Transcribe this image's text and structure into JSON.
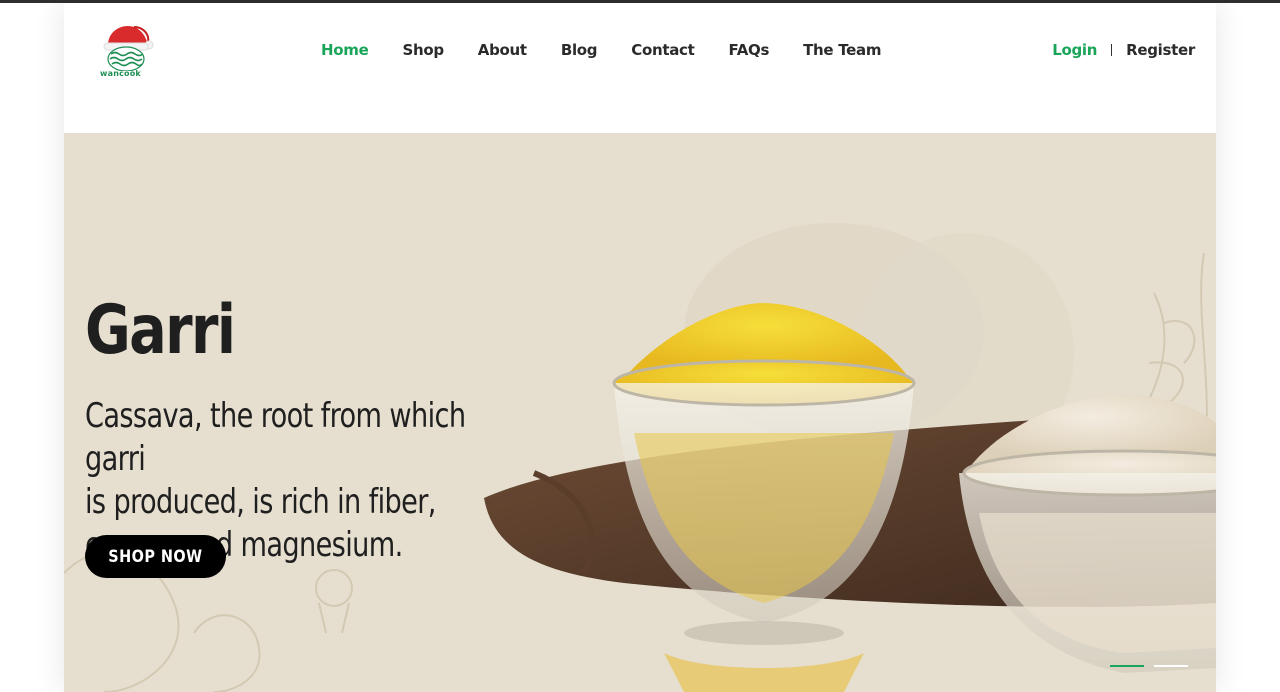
{
  "brand": {
    "name": "wancook",
    "logo_icon": "santa-hat-wave-logo",
    "accent": "#1aa55a"
  },
  "nav": {
    "items": [
      {
        "label": "Home",
        "active": true
      },
      {
        "label": "Shop",
        "active": false
      },
      {
        "label": "About",
        "active": false
      },
      {
        "label": "Blog",
        "active": false
      },
      {
        "label": "Contact",
        "active": false
      },
      {
        "label": "FAQs",
        "active": false
      },
      {
        "label": "The Team",
        "active": false
      }
    ]
  },
  "auth": {
    "login": "Login",
    "register": "Register"
  },
  "hero": {
    "title": "Garri",
    "subtitle_lines": [
      "Cassava, the root from which garri",
      "is produced, is rich in fiber,",
      "copper and magnesium."
    ],
    "cta": "SHOP NOW",
    "background": "#e6dfcf",
    "slides": [
      {
        "active": true
      },
      {
        "active": false
      }
    ]
  }
}
